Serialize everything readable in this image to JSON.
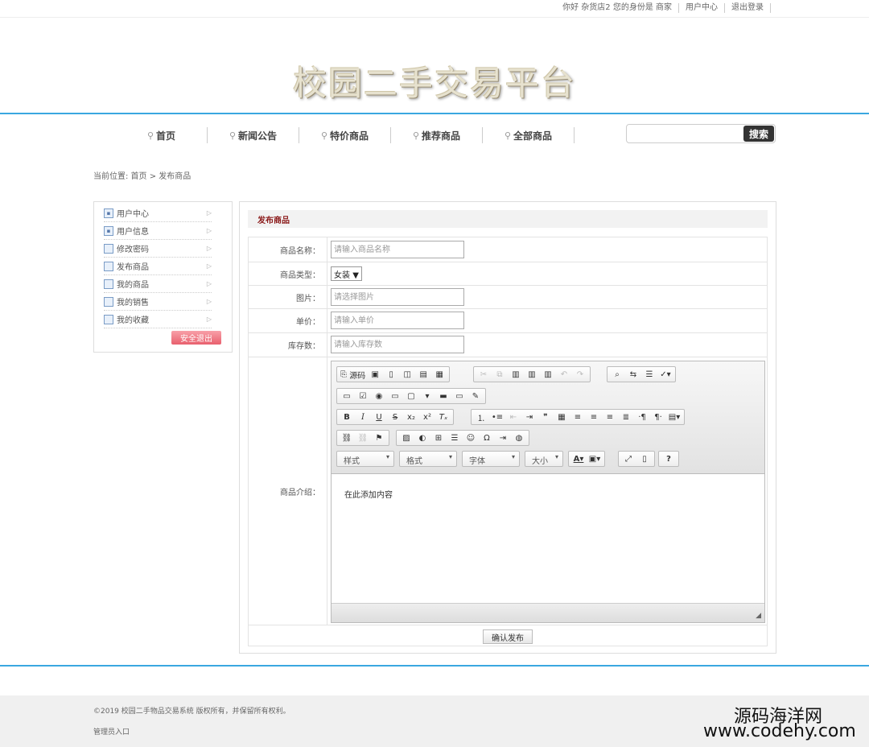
{
  "topbar": {
    "greeting": "你好 杂货店2 您的身份是 商家",
    "user_center": "用户中心",
    "logout": "退出登录"
  },
  "logo": "校园二手交易平台",
  "nav": {
    "items": [
      "首页",
      "新闻公告",
      "特价商品",
      "推荐商品",
      "全部商品"
    ],
    "search_button": "搜索",
    "search_value": ""
  },
  "breadcrumb": "当前位置: 首页 > 发布商品",
  "sidebar": {
    "items": [
      "用户中心",
      "用户信息",
      "修改密码",
      "发布商品",
      "我的商品",
      "我的销售",
      "我的收藏"
    ],
    "logout_button": "安全退出"
  },
  "panel": {
    "title": "发布商品",
    "fields": {
      "name_label": "商品名称：",
      "name_placeholder": "请输入商品名称",
      "type_label": "商品类型：",
      "type_value": "女装",
      "image_label": "图片：",
      "image_placeholder": "请选择图片",
      "price_label": "单价：",
      "price_placeholder": "请输入单价",
      "stock_label": "库存数：",
      "stock_placeholder": "请输入库存数",
      "desc_label": "商品介绍："
    },
    "editor": {
      "source_label": "源码",
      "combos": [
        "样式",
        "格式",
        "字体",
        "大小"
      ],
      "content": "在此添加内容"
    },
    "submit_button": "确认发布"
  },
  "footer": {
    "copyright": "©2019 校园二手物品交易系统 版权所有，并保留所有权利。",
    "admin_link": "管理员入口"
  },
  "watermark": {
    "line1": "源码海洋网",
    "line2": "www.codehy.com"
  }
}
